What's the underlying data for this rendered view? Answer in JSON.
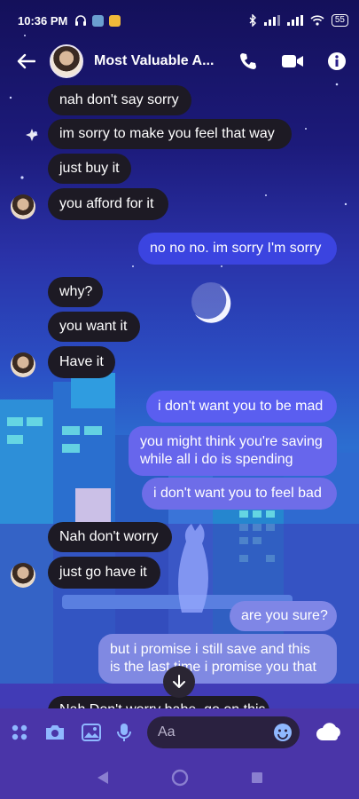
{
  "status_bar": {
    "time": "10:36 PM",
    "battery": "55"
  },
  "header": {
    "title": "Most Valuable A..."
  },
  "messages": [
    {
      "text": "nah don't say sorry"
    },
    {
      "text": "im sorry to make you feel that way"
    },
    {
      "text": "just buy it"
    },
    {
      "text": "you afford for it"
    },
    {
      "text": "no no no. im sorry I'm sorry"
    },
    {
      "text": "why?"
    },
    {
      "text": "you want it"
    },
    {
      "text": "Have it"
    },
    {
      "text": "i don't want you to be mad"
    },
    {
      "line1": "you might think you're saving",
      "line2": "while all i do is spending"
    },
    {
      "text": "i don't want you to feel bad"
    },
    {
      "text": "Nah don't worry"
    },
    {
      "text": "just go have it"
    },
    {
      "text": "are you sure?"
    },
    {
      "line1": "but i promise i still save and this",
      "line2": "is the last time i promise you that"
    },
    {
      "text": "Nah Don't worry babe, go on this"
    }
  ],
  "composer": {
    "placeholder": "Aa"
  },
  "colors": {
    "incoming": "#1d1a24",
    "outgoing_top": "#3b44e0",
    "outgoing_bottom": "#7f86e6",
    "bar": "#4a35a8"
  },
  "icons": [
    "back-arrow-icon",
    "phone-icon",
    "video-icon",
    "info-icon",
    "menu-dots-icon",
    "camera-icon",
    "image-icon",
    "mic-icon",
    "emoji-icon",
    "cloud-icon",
    "chevron-down-icon"
  ]
}
